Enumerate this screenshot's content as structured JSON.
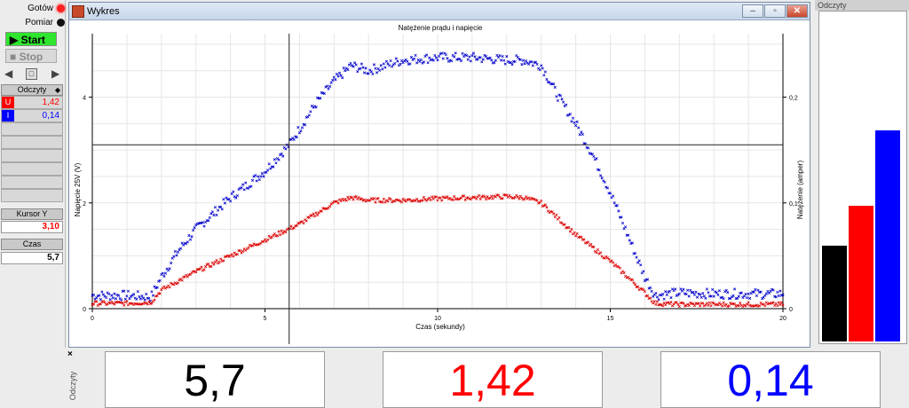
{
  "left_panel": {
    "status_ready": "Gotów",
    "status_measure": "Pomiar",
    "start_label": "Start",
    "stop_label": "Stop",
    "readings_header": "Odczyty",
    "u_tag": "U",
    "u_value": "1,42",
    "i_tag": "I",
    "i_value": "0,14",
    "cursor_header": "Kursor Y",
    "cursor_value": "3,10",
    "time_header": "Czas",
    "time_value": "5,7"
  },
  "window": {
    "title": "Wykres",
    "min_label": "–",
    "max_label": "▫",
    "close_label": "✕"
  },
  "bar_panel": {
    "title": "Odczyty",
    "levels": [
      0.29,
      0.41,
      0.64
    ],
    "colors": [
      "#000000",
      "#ff0000",
      "#0000ff"
    ]
  },
  "bottom": {
    "close_label": "×",
    "vertical_label": "Odczyty",
    "values": [
      "5,7",
      "1,42",
      "0,14"
    ],
    "colors": [
      "#000000",
      "#ff0000",
      "#0000ff"
    ]
  },
  "chart_data": {
    "type": "scatter",
    "title": "Natężenie prądu i napięcie",
    "xlabel": "Czas (sekundy)",
    "ylabel_left": "Napięcie 25V (V)",
    "ylabel_right": "Natężenie (amper)",
    "xlim": [
      0,
      20
    ],
    "ylim_left": [
      0,
      5.2
    ],
    "ylim_right": [
      0,
      0.26
    ],
    "x_ticks": [
      "0",
      "5",
      "10",
      "15",
      "20"
    ],
    "y_left_ticks": [
      "0",
      "2",
      "4"
    ],
    "y_right_ticks": [
      "0",
      "0,1",
      "0,2"
    ],
    "grid": true,
    "cursor": {
      "x": 5.7,
      "y": 3.1
    },
    "series": [
      {
        "color": "#0000cc",
        "axis": "left",
        "x": [
          0,
          1,
          1.7,
          2,
          2.5,
          3,
          4,
          5,
          5.7,
          6,
          6.5,
          7,
          7.5,
          8,
          8.5,
          9,
          10,
          11,
          12,
          12.5,
          13,
          13.5,
          14,
          14.5,
          15,
          15.5,
          16,
          16.3,
          17,
          18,
          19,
          20
        ],
        "y": [
          0.25,
          0.25,
          0.22,
          0.6,
          1.1,
          1.5,
          2.1,
          2.6,
          3.1,
          3.4,
          3.9,
          4.3,
          4.6,
          4.5,
          4.6,
          4.7,
          4.75,
          4.75,
          4.7,
          4.7,
          4.6,
          4.0,
          3.5,
          2.9,
          2.2,
          1.4,
          0.6,
          0.25,
          0.3,
          0.28,
          0.28,
          0.28
        ]
      },
      {
        "color": "#dd0000",
        "axis": "left",
        "x": [
          0,
          1,
          1.7,
          2,
          3,
          4,
          5,
          6,
          6.5,
          7,
          7.5,
          8,
          9,
          10,
          11,
          12,
          12.5,
          13,
          13.5,
          14,
          15,
          15.5,
          16,
          16.3,
          17,
          18,
          19,
          20
        ],
        "y": [
          0.1,
          0.1,
          0.12,
          0.35,
          0.7,
          1.0,
          1.3,
          1.6,
          1.8,
          2.0,
          2.1,
          2.05,
          2.05,
          2.08,
          2.1,
          2.12,
          2.1,
          2.0,
          1.7,
          1.4,
          0.9,
          0.6,
          0.3,
          0.1,
          0.08,
          0.08,
          0.08,
          0.08
        ]
      }
    ]
  }
}
